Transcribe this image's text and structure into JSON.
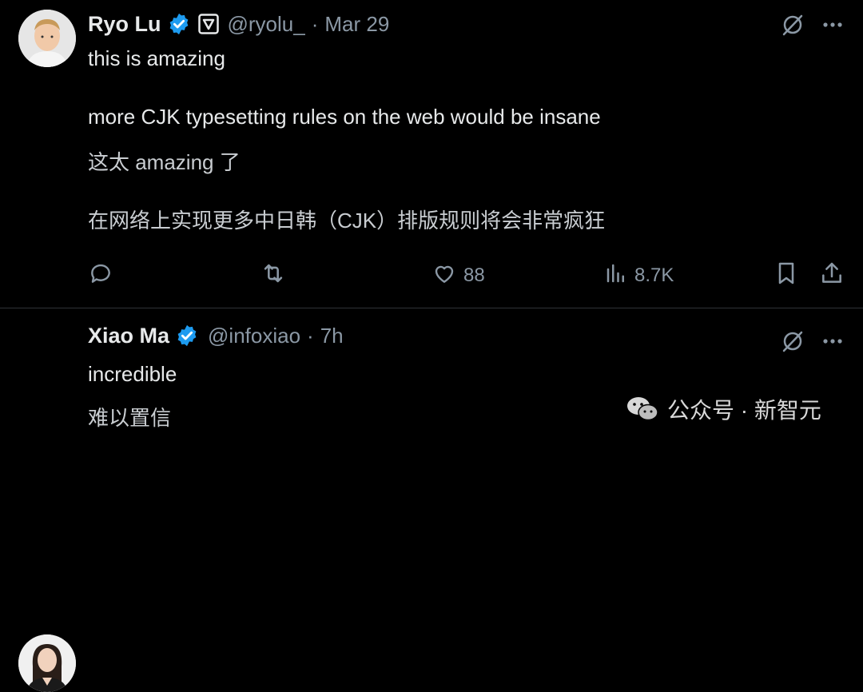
{
  "tweets": [
    {
      "author_name": "Ryo Lu",
      "handle": "@ryolu_",
      "time": "Mar 29",
      "separator": "·",
      "lines": [
        "this is amazing",
        "more CJK typesetting rules on the web would be insane"
      ],
      "translation": [
        "这太 amazing 了",
        "在网络上实现更多中日韩（CJK）排版规则将会非常疯狂"
      ],
      "actions": {
        "reply_count": "",
        "repost_count": "",
        "like_count": "88",
        "views_count": "8.7K"
      }
    },
    {
      "author_name": "Xiao Ma",
      "handle": "@infoxiao",
      "time": "7h",
      "separator": "·",
      "lines": [
        "incredible"
      ],
      "translation": [
        "难以置信"
      ]
    }
  ],
  "icons": {
    "verified": "verified-badge-icon",
    "affiliation": "affiliation-badge-icon",
    "grok": "grok-icon",
    "more": "more-icon",
    "reply": "reply-icon",
    "repost": "repost-icon",
    "like": "like-icon",
    "views": "views-icon",
    "bookmark": "bookmark-icon",
    "share": "share-icon",
    "wechat": "wechat-icon"
  },
  "watermark": {
    "text": "公众号 · 新智元"
  },
  "colors": {
    "background": "#000000",
    "text": "#e7e9ea",
    "muted": "#8b98a5",
    "verified": "#1d9bf0",
    "divider": "#2f3336"
  }
}
